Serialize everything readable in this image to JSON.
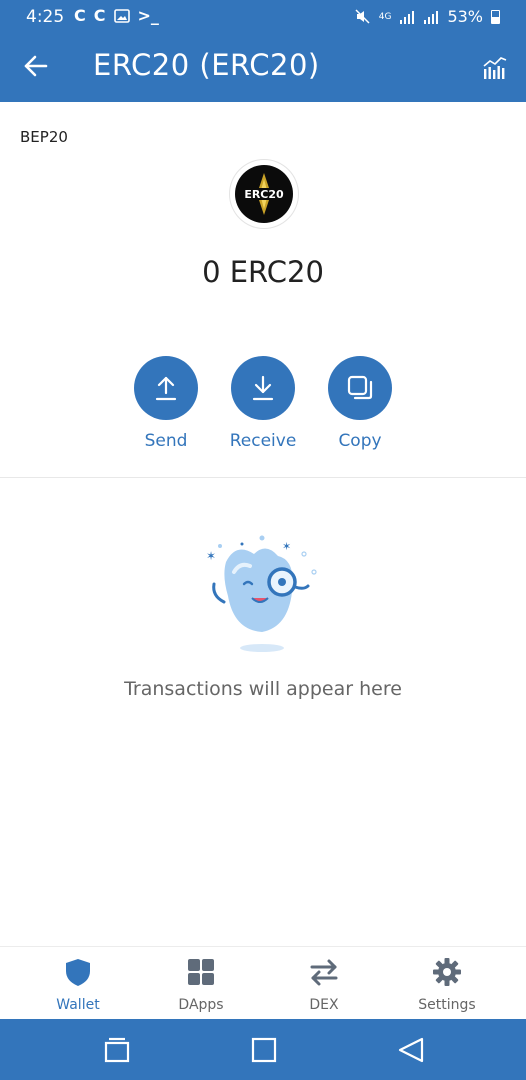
{
  "status_bar": {
    "time": "4:25",
    "network": "4G",
    "battery": "53%"
  },
  "header": {
    "title": "ERC20 (ERC20)"
  },
  "token": {
    "network": "BEP20",
    "logo_text": "ERC20",
    "balance": "0 ERC20"
  },
  "actions": [
    {
      "label": "Send",
      "icon": "arrow-up-icon"
    },
    {
      "label": "Receive",
      "icon": "arrow-down-icon"
    },
    {
      "label": "Copy",
      "icon": "copy-icon"
    }
  ],
  "empty_state": {
    "message": "Transactions will appear here"
  },
  "bottom_nav": [
    {
      "label": "Wallet",
      "icon": "shield-icon",
      "active": true
    },
    {
      "label": "DApps",
      "icon": "grid-icon",
      "active": false
    },
    {
      "label": "DEX",
      "icon": "swap-icon",
      "active": false
    },
    {
      "label": "Settings",
      "icon": "gear-icon",
      "active": false
    }
  ],
  "colors": {
    "primary": "#3375bb",
    "background": "#ffffff",
    "muted_text": "#666666"
  }
}
